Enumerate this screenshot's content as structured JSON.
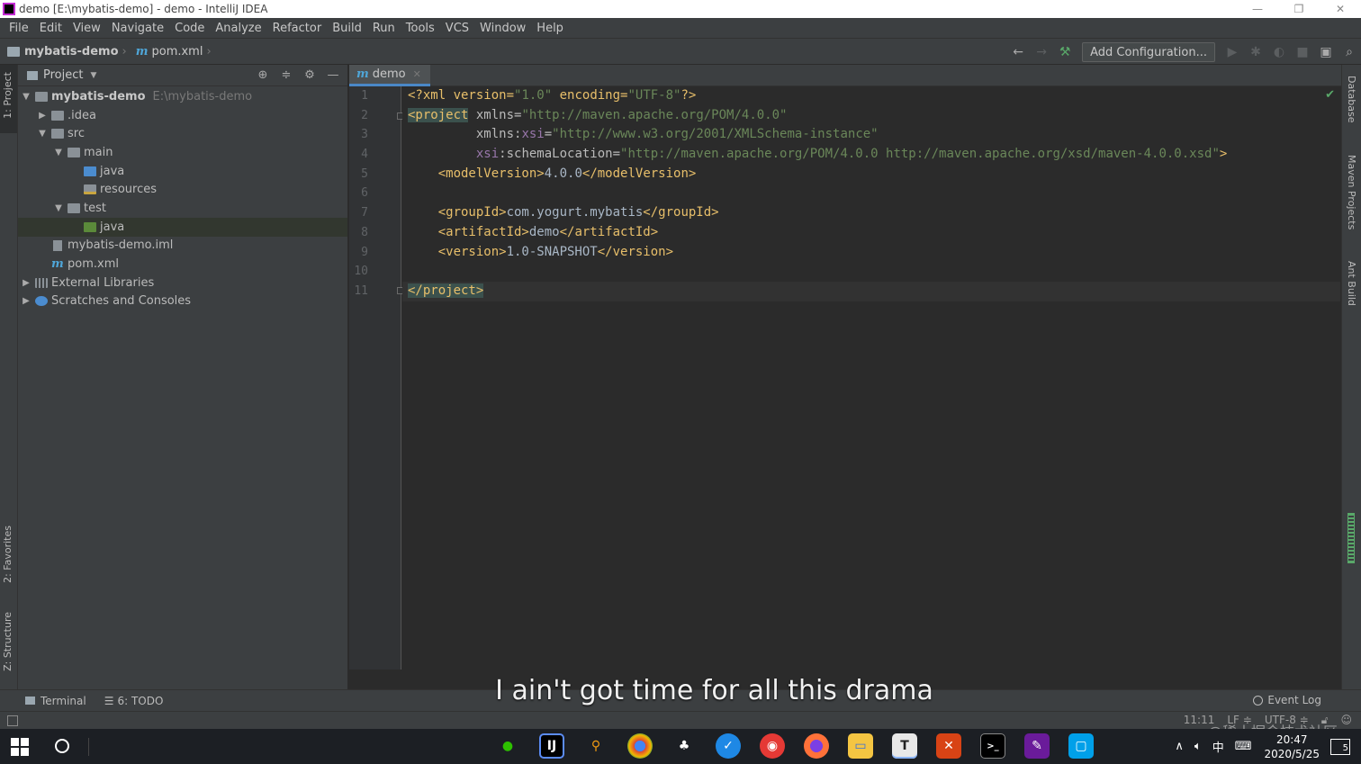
{
  "window": {
    "title": "demo [E:\\mybatis-demo] - demo - IntelliJ IDEA",
    "controls": [
      "—",
      "❐",
      "✕"
    ]
  },
  "menu": [
    "File",
    "Edit",
    "View",
    "Navigate",
    "Code",
    "Analyze",
    "Refactor",
    "Build",
    "Run",
    "Tools",
    "VCS",
    "Window",
    "Help"
  ],
  "breadcrumb": {
    "project": "mybatis-demo",
    "file": "pom.xml"
  },
  "toolbar": {
    "add_configuration": "Add Configuration..."
  },
  "left_stripe": {
    "project": "1: Project",
    "favorites": "2: Favorites",
    "structure": "Z: Structure"
  },
  "right_stripe": {
    "database": "Database",
    "maven": "Maven Projects",
    "ant": "Ant Build"
  },
  "project_panel": {
    "title": "Project",
    "tree": [
      {
        "label": "mybatis-demo",
        "path": "E:\\mybatis-demo"
      },
      {
        "label": ".idea"
      },
      {
        "label": "src"
      },
      {
        "label": "main"
      },
      {
        "label": "java"
      },
      {
        "label": "resources"
      },
      {
        "label": "test"
      },
      {
        "label": "java"
      },
      {
        "label": "mybatis-demo.iml"
      },
      {
        "label": "pom.xml"
      },
      {
        "label": "External Libraries"
      },
      {
        "label": "Scratches and Consoles"
      }
    ]
  },
  "editor": {
    "tab": "demo",
    "line_numbers": [
      "1",
      "2",
      "3",
      "4",
      "5",
      "6",
      "7",
      "8",
      "9",
      "10",
      "11"
    ],
    "lines": [
      {
        "t1": "<?xml version=",
        "v1": "\"1.0\"",
        "t2": " encoding=",
        "v2": "\"UTF-8\"",
        "t3": "?>"
      },
      {
        "open": "<project",
        "a1": " xmlns=",
        "v1": "\"http://maven.apache.org/POM/4.0.0\""
      },
      {
        "indent": "         ",
        "a1": "xmlns:",
        "ns": "xsi",
        "a2": "=",
        "v1": "\"http://www.w3.org/2001/XMLSchema-instance\""
      },
      {
        "indent": "         ",
        "ns": "xsi",
        "a1": ":schemaLocation=",
        "v1": "\"http://maven.apache.org/POM/4.0.0 http://maven.apache.org/xsd/maven-4.0.0.xsd\"",
        "close": ">"
      },
      {
        "indent": "    ",
        "o": "<modelVersion>",
        "text": "4.0.0",
        "c": "</modelVersion>"
      },
      {},
      {
        "indent": "    ",
        "o": "<groupId>",
        "text": "com.yogurt.mybatis",
        "c": "</groupId>"
      },
      {
        "indent": "    ",
        "o": "<artifactId>",
        "text": "demo",
        "c": "</artifactId>"
      },
      {
        "indent": "    ",
        "o": "<version>",
        "text": "1.0-SNAPSHOT",
        "c": "</version>"
      },
      {},
      {
        "end": "</project>"
      }
    ]
  },
  "bottom_tabs": {
    "terminal": "Terminal",
    "todo": "6: TODO",
    "event_log": "Event Log"
  },
  "status": {
    "position": "11:11",
    "line_sep": "LF ≑",
    "encoding": "UTF-8 ≑"
  },
  "subtitle": "I ain't got time for all this drama",
  "watermark": "@稀土掘金技术社区",
  "taskbar": {
    "tray_ime": "中",
    "time": "20:47",
    "date": "2020/5/25",
    "notifications": "5"
  }
}
